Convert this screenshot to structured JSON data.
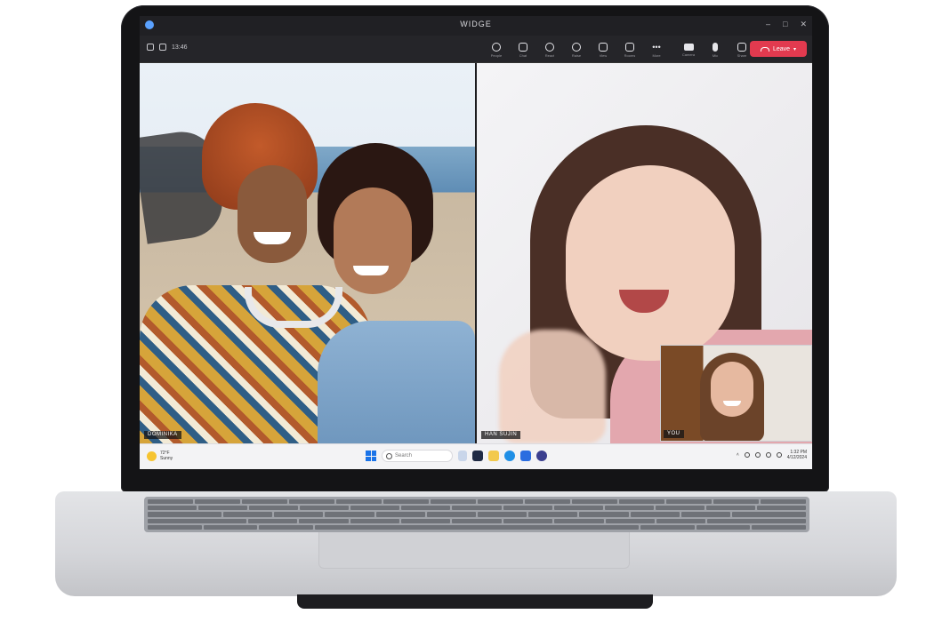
{
  "window": {
    "title": "WIDGE",
    "controls": [
      "–",
      "□",
      "✕"
    ]
  },
  "toolbar": {
    "left_timer": "13:46",
    "tools": [
      {
        "icon": "people-icon",
        "label": "People"
      },
      {
        "icon": "chat-icon",
        "label": "Chat"
      },
      {
        "icon": "reactions-icon",
        "label": "React"
      },
      {
        "icon": "raise-hand-icon",
        "label": "Raise"
      },
      {
        "icon": "view-icon",
        "label": "View"
      },
      {
        "icon": "rooms-icon",
        "label": "Rooms"
      },
      {
        "icon": "more-icon",
        "label": "More"
      }
    ],
    "media": [
      {
        "icon": "camera-icon",
        "label": "Camera"
      },
      {
        "icon": "mic-icon",
        "label": "Mic"
      },
      {
        "icon": "share-icon",
        "label": "Share"
      }
    ],
    "leave_label": "Leave"
  },
  "participants": [
    {
      "name": "DOMINIKA"
    },
    {
      "name": "HAN SUJIN"
    }
  ],
  "self_view": {
    "name": "YOU"
  },
  "taskbar": {
    "weather_temp": "72°F",
    "weather_desc": "Sunny",
    "search_placeholder": "Search",
    "clock_time": "1:32 PM",
    "clock_date": "4/12/2024"
  },
  "colors": {
    "leave_button": "#e23a4f",
    "accent": "#1a73e8"
  }
}
